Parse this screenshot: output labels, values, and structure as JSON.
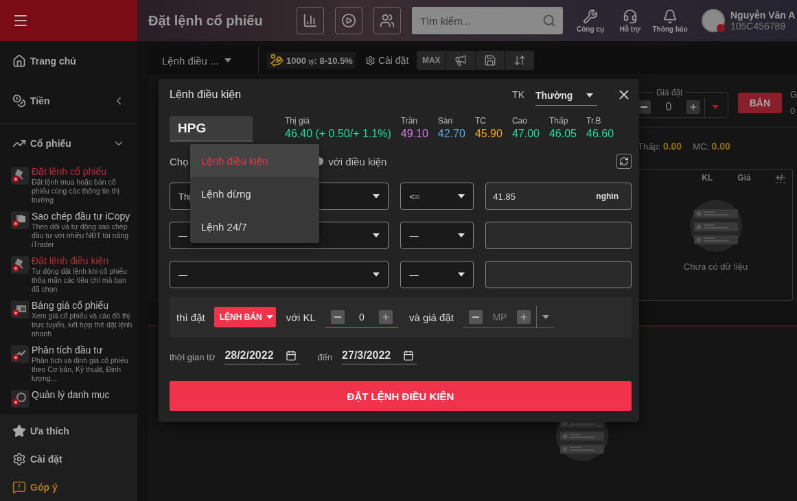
{
  "sidebar": {
    "top_items": [
      {
        "label": "Trang chủ"
      },
      {
        "label": "Tiền",
        "expanded": false
      }
    ],
    "section": {
      "label": "Cổ phiếu",
      "expanded": true,
      "items": [
        {
          "title": "Đặt lệnh cổ phiếu",
          "description": "Đặt lệnh mua hoặc bán cổ phiếu cùng các thông tin thị trường",
          "selected": true
        },
        {
          "title": "Sao chép đầu tư iCopy",
          "description": "Theo dõi và tự động sao chép đầu tư với nhiều NĐT tài năng iTrader",
          "selected": false
        },
        {
          "title": "Đặt lệnh điều kiện",
          "description": "Tự động đặt lệnh khi cổ phiếu thỏa mãn các tiêu chí mà bạn đã chọn",
          "selected": true
        },
        {
          "title": "Bảng giá cổ phiếu",
          "description": "Xem giá cổ phiếu và các đồ thị trực tuyến, kết hợp thẻ đặt lệnh nhanh",
          "selected": false
        },
        {
          "title": "Phân tích đầu tư",
          "description": "Phân tích và định giá cổ phiếu theo Cơ bản, Kỹ thuật, Định lượng...",
          "selected": false
        },
        {
          "title": "Quản lý danh mục",
          "selected": false
        }
      ]
    },
    "bottom_items": [
      {
        "label": "Ưa thích",
        "kind": "normal"
      },
      {
        "label": "Cài đặt",
        "kind": "normal"
      },
      {
        "label": "Góp ý",
        "kind": "feedback"
      }
    ]
  },
  "header": {
    "title": "Đặt lệnh cổ phiếu",
    "search": {
      "placeholder": "Tìm kiếm..."
    },
    "tools": [
      {
        "label": "Công cụ"
      },
      {
        "label": "Hỗ trợ"
      },
      {
        "label": "Thông báo"
      }
    ],
    "user": {
      "name": "Nguyễn Văn A",
      "account": "105C456789"
    }
  },
  "toolbar": {
    "order_type": "Lệnh điều ...",
    "promo": {
      "amount": "1000",
      "unit": "tỷ",
      "rate": ": 8-10.5%"
    },
    "settings": "Cài đặt",
    "max": "MAX"
  },
  "order_panel": {
    "price_label": "Giá đặt",
    "price": "0",
    "sell": "BÁN",
    "next_label": "G",
    "next_value": "0"
  },
  "stats": [
    {
      "label": "Thấp:",
      "value": "0.00"
    },
    {
      "label": "MC:",
      "value": "0.00"
    }
  ],
  "table": {
    "columns": [
      "KL",
      "Giá",
      "+/-"
    ],
    "empty": "Chưa có dữ liệu"
  },
  "modal": {
    "title": "Lệnh điều kiện",
    "account": {
      "label": "TK",
      "value": "Thường"
    },
    "symbol": "HPG",
    "quote": {
      "label": "Thị giá",
      "value": "46.40 (+ 0.50/+ 1.1%)"
    },
    "prices": [
      {
        "label": "Trần",
        "value": "49.10",
        "color": "#d77be8"
      },
      {
        "label": "Sàn",
        "value": "42.70",
        "color": "#5aa7ee"
      },
      {
        "label": "TC",
        "value": "45.90",
        "color": "#f0a523"
      },
      {
        "label": "Cao",
        "value": "47.00",
        "color": "#20dca0"
      },
      {
        "label": "Thấp",
        "value": "46.05",
        "color": "#20dca0"
      },
      {
        "label": "Tr.B",
        "value": "46.60",
        "color": "#20dca0"
      }
    ],
    "choose_label": "Chọ",
    "condition_radio": {
      "selected": true
    },
    "condition_label": "với điều kiện",
    "conditions": [
      {
        "field": "Thị",
        "operator": "<=",
        "value": "41.85",
        "unit": "nghìn"
      },
      {
        "field": "—",
        "operator": "—"
      },
      {
        "field": "—",
        "operator": "—"
      }
    ],
    "action": {
      "label": "thì đặt",
      "side": "LỆNH BÁN",
      "qty_label": "với KL",
      "qty": "0",
      "price_label": "và giá đặt",
      "price": "MP"
    },
    "dates": {
      "from_label": "thời gian từ",
      "from": "28/2/2022",
      "to_label": "đến",
      "to": "27/3/2022"
    },
    "submit": "ĐẶT LỆNH ĐIỀU KIỆN",
    "menu": [
      {
        "label": "Lệnh điều kiện",
        "selected": true
      },
      {
        "label": "Lệnh dừng",
        "selected": false
      },
      {
        "label": "Lệnh 24/7",
        "selected": false
      }
    ]
  }
}
